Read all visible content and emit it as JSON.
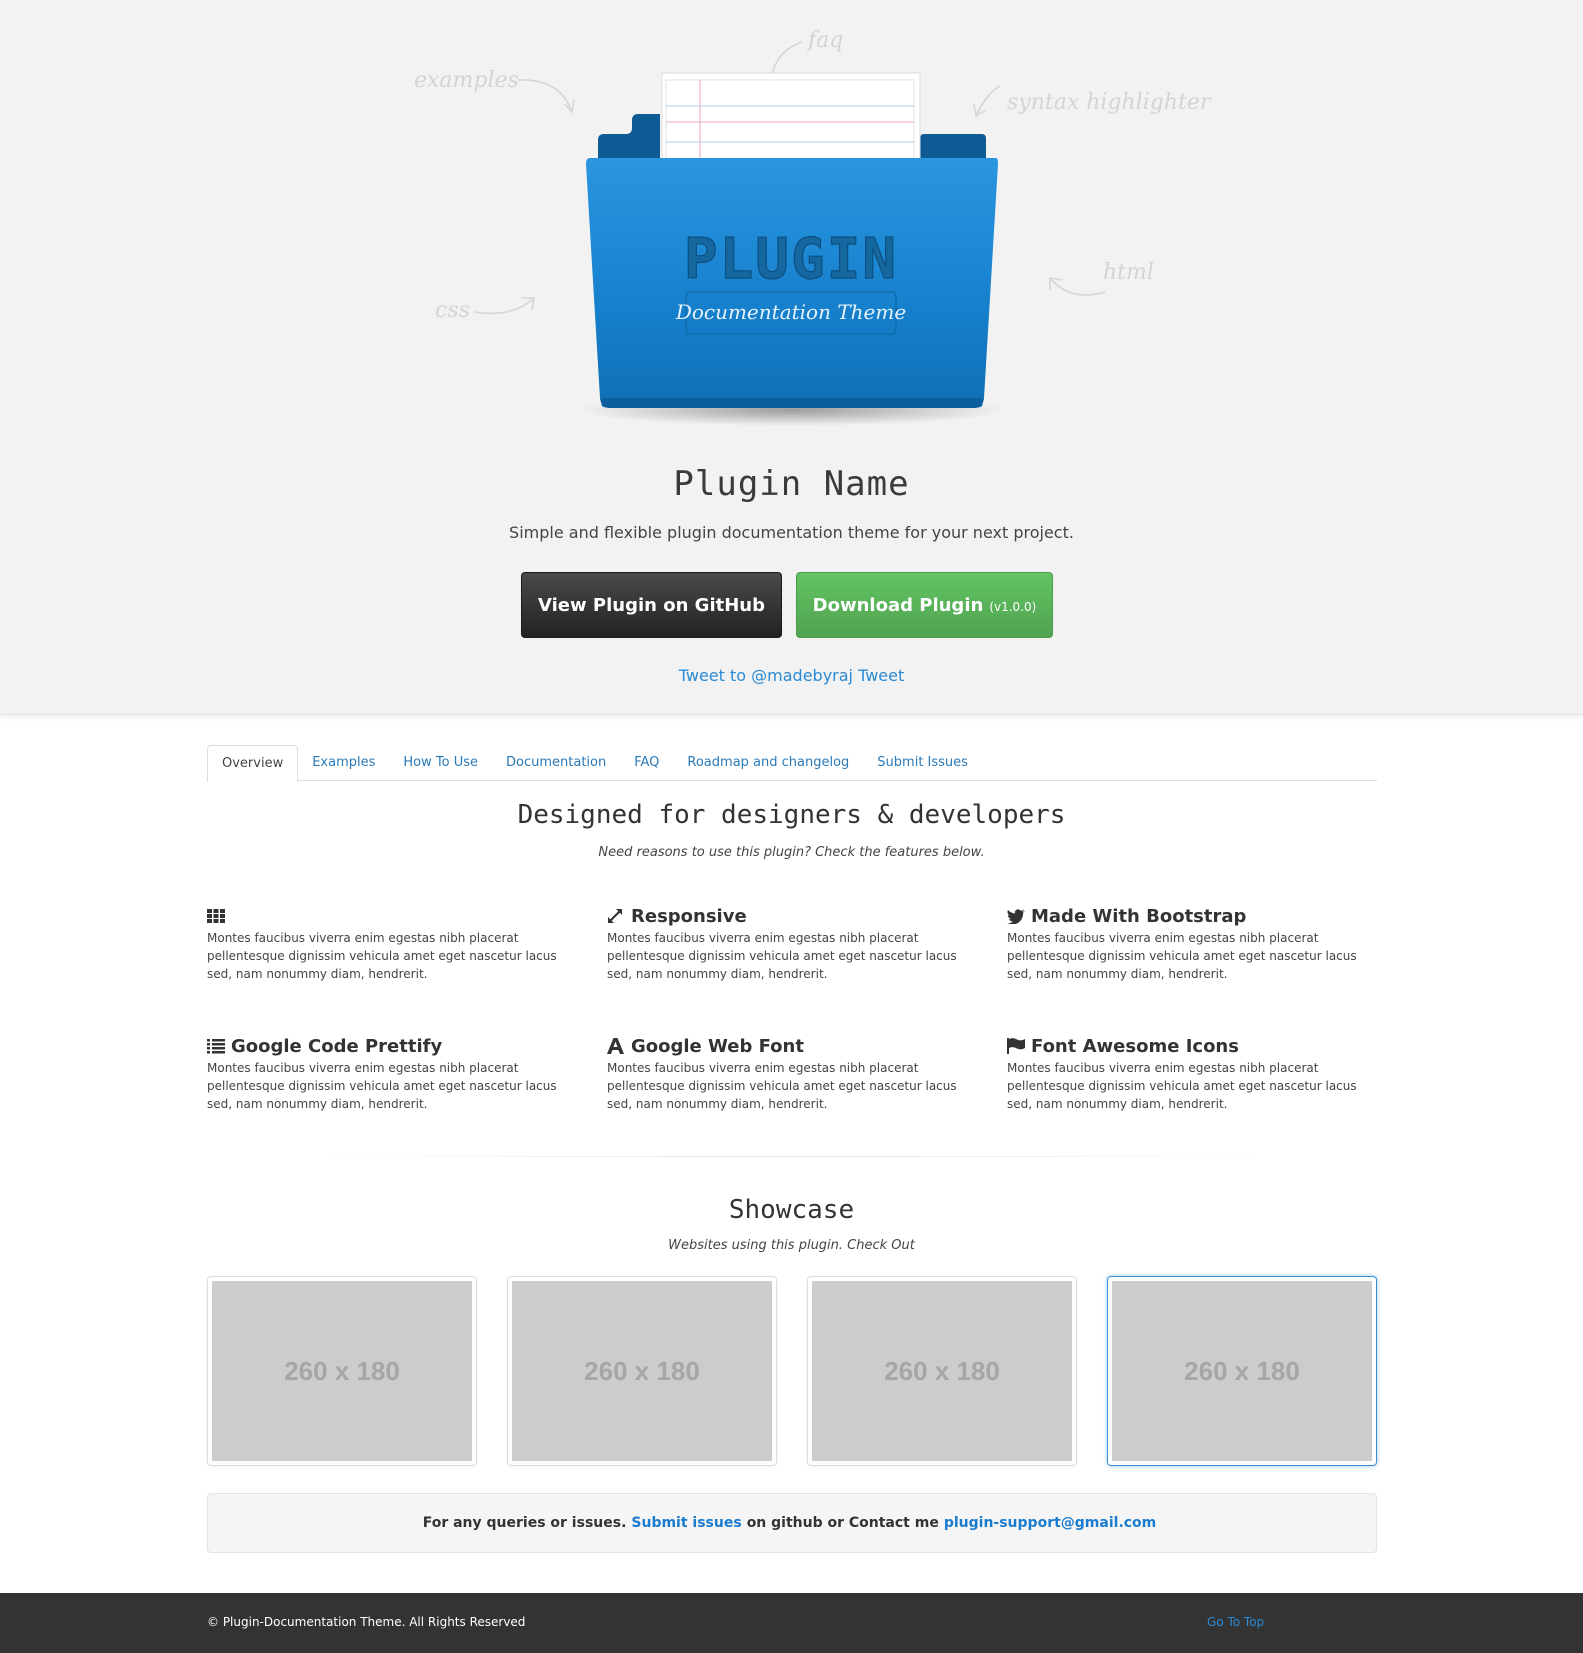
{
  "hero": {
    "doodles": {
      "examples": "examples",
      "faq": "faq",
      "syntax": "syntax highlighter",
      "html": "html",
      "css": "css"
    },
    "logo_main": "PLUGIN",
    "logo_sub": "Documentation Theme",
    "title": "Plugin Name",
    "subtitle": "Simple and flexible plugin documentation theme for your next project.",
    "github_label": "View Plugin on GitHub",
    "download_label": "Download Plugin",
    "download_version": "(v1.0.0)",
    "tweet_label": "Tweet to @madebyraj",
    "tweet_suffix": "Tweet"
  },
  "tabs": [
    "Overview",
    "Examples",
    "How To Use",
    "Documentation",
    "FAQ",
    "Roadmap and changelog",
    "Submit Issues"
  ],
  "features_section": {
    "title": "Designed for designers & developers",
    "subtitle": "Need reasons to use this plugin? Check the features below."
  },
  "features": [
    {
      "icon": "grid-icon",
      "title": "",
      "text": "Montes faucibus viverra enim egestas nibh placerat pellentesque dignissim vehicula amet eget nascetur lacus sed, nam nonummy diam, hendrerit."
    },
    {
      "icon": "resize-icon",
      "title": "Responsive",
      "text": "Montes faucibus viverra enim egestas nibh placerat pellentesque dignissim vehicula amet eget nascetur lacus sed, nam nonummy diam, hendrerit."
    },
    {
      "icon": "twitter-icon",
      "title": "Made With Bootstrap",
      "text": "Montes faucibus viverra enim egestas nibh placerat pellentesque dignissim vehicula amet eget nascetur lacus sed, nam nonummy diam, hendrerit."
    },
    {
      "icon": "list-icon",
      "title": "Google Code Prettify",
      "text": "Montes faucibus viverra enim egestas nibh placerat pellentesque dignissim vehicula amet eget nascetur lacus sed, nam nonummy diam, hendrerit."
    },
    {
      "icon": "font-icon",
      "title": "Google Web Font",
      "text": "Montes faucibus viverra enim egestas nibh placerat pellentesque dignissim vehicula amet eget nascetur lacus sed, nam nonummy diam, hendrerit."
    },
    {
      "icon": "flag-icon",
      "title": "Font Awesome Icons",
      "text": "Montes faucibus viverra enim egestas nibh placerat pellentesque dignissim vehicula amet eget nascetur lacus sed, nam nonummy diam, hendrerit."
    }
  ],
  "showcase": {
    "title": "Showcase",
    "subtitle": "Websites using this plugin. Check Out",
    "thumbs": [
      "260 x 180",
      "260 x 180",
      "260 x 180",
      "260 x 180"
    ]
  },
  "contact": {
    "prefix": "For any queries or issues.",
    "link1": "Submit issues",
    "middle": "on github or Contact me",
    "email": "plugin-support@gmail.com"
  },
  "footer": {
    "copyright": "© Plugin-Documentation Theme. All Rights Reserved",
    "go_top": "Go To Top"
  },
  "colors": {
    "hero_bg": "#f2f2f2",
    "folder_blue": "#1a86d4",
    "link_blue": "#2a8ad4",
    "github_btn": "#2f2f2f",
    "download_btn": "#5cb85c",
    "footer_bg": "#333333"
  }
}
